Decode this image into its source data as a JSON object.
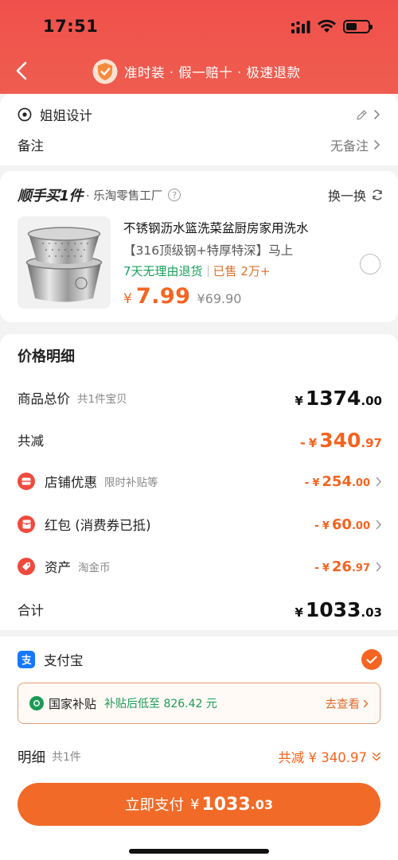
{
  "status_bar": {
    "time": "17:51"
  },
  "nav": {
    "guarantee_text": "准时装 · 假一赔十 · 极速退款"
  },
  "address": {
    "name": "姐姐设计",
    "note_label": "备注",
    "note_value": "无备注"
  },
  "shop": {
    "brand": "顺手买1件",
    "name": "· 乐淘零售工厂",
    "help": "?",
    "swap": "换一换"
  },
  "product": {
    "title": "不锈钢沥水篮洗菜盆厨房家用洗水",
    "spec": "【316顶级钢+特厚特深】马上",
    "return_tag": "7天无理由退货",
    "sold_tag": "已售 2万+",
    "currency": "¥",
    "price": "7.99",
    "original_price": "¥69.90"
  },
  "price_detail": {
    "title": "价格明细",
    "lines": [
      {
        "label": "商品总价",
        "sub": "共1件宝贝",
        "prefix": "",
        "currency": "¥",
        "int": "1374",
        "dec": ".00"
      },
      {
        "label": "共减",
        "sub": "",
        "prefix": "-",
        "currency": "¥",
        "int": "340",
        "dec": ".97"
      },
      {
        "label": "店铺优惠",
        "sub": "限时补贴等",
        "prefix": "-",
        "currency": "¥",
        "int": "254",
        "dec": ".00",
        "icon": "shop-coupon-icon"
      },
      {
        "label": "红包 (消费券已抵)",
        "sub": "",
        "prefix": "-",
        "currency": "¥",
        "int": "60",
        "dec": ".00",
        "icon": "red-packet-icon"
      },
      {
        "label": "资产",
        "sub": "淘金币",
        "prefix": "-",
        "currency": "¥",
        "int": "26",
        "dec": ".97",
        "icon": "coin-tag-icon"
      },
      {
        "label": "合计",
        "sub": "",
        "prefix": "",
        "currency": "¥",
        "int": "1033",
        "dec": ".03"
      }
    ]
  },
  "payment": {
    "method": "支付宝",
    "subsidy_title": "国家补贴",
    "subsidy_desc": "补贴后低至 826.42 元",
    "subsidy_link": "去查看",
    "detail_label": "明细",
    "detail_count": "共1件",
    "detail_total": "共减 ¥ 340.97",
    "pay_label": "立即支付",
    "pay_currency": "¥",
    "pay_int": "1033",
    "pay_dec": ".03"
  },
  "colors": {
    "accent": "#f56420",
    "header": "#f0504c",
    "green": "#18a15b",
    "alipay": "#1677ff"
  }
}
